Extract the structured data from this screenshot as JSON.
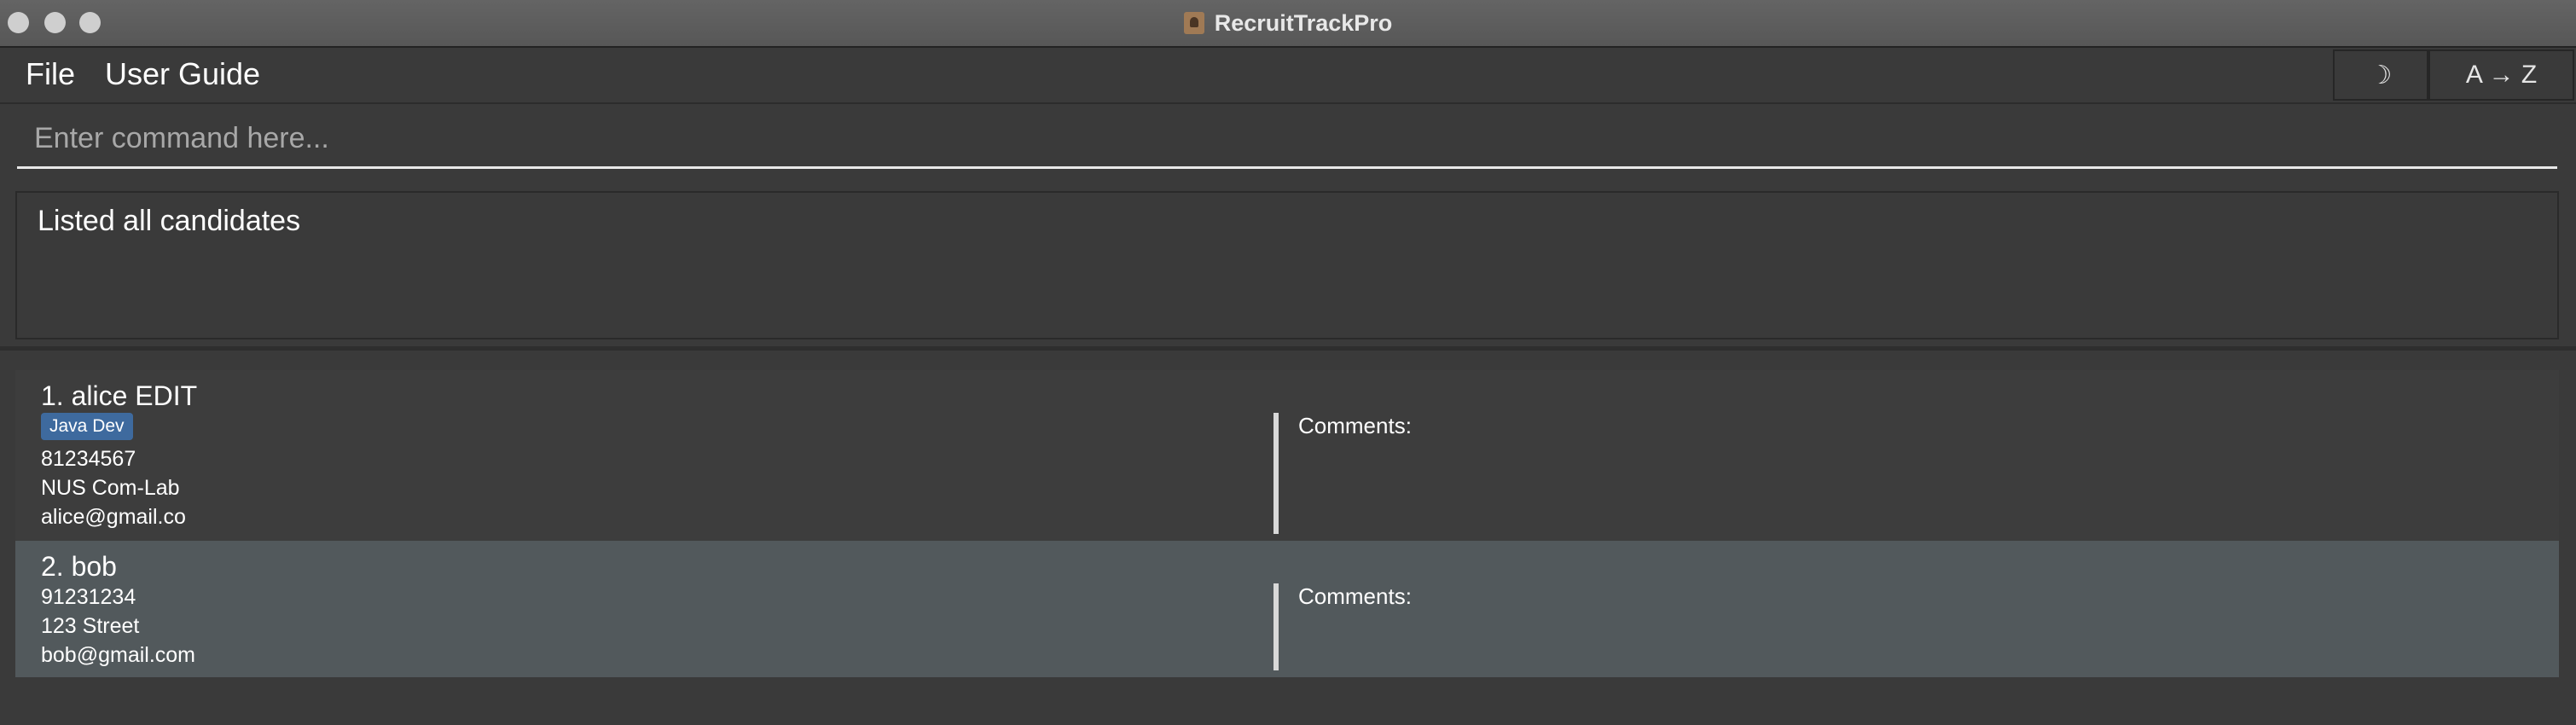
{
  "window": {
    "title": "RecruitTrackPro"
  },
  "menu": {
    "file": "File",
    "user_guide": "User Guide"
  },
  "toolbar": {
    "theme_toggle": "☽",
    "sort_label": "A → Z"
  },
  "command": {
    "placeholder": "Enter command here...",
    "value": ""
  },
  "result": {
    "message": "Listed all candidates"
  },
  "candidates": [
    {
      "heading": "1. alice EDIT",
      "tags": [
        "Java Dev"
      ],
      "phone": "81234567",
      "address": "NUS Com-Lab",
      "email": "alice@gmail.co",
      "comments_label": "Comments:"
    },
    {
      "heading": "2. bob",
      "tags": [],
      "phone": "91231234",
      "address": "123 Street",
      "email": "bob@gmail.com",
      "comments_label": "Comments:"
    }
  ],
  "colors": {
    "background": "#3a3a3a",
    "tag_background": "#3e6a9e",
    "selected_row": "#52595c"
  }
}
